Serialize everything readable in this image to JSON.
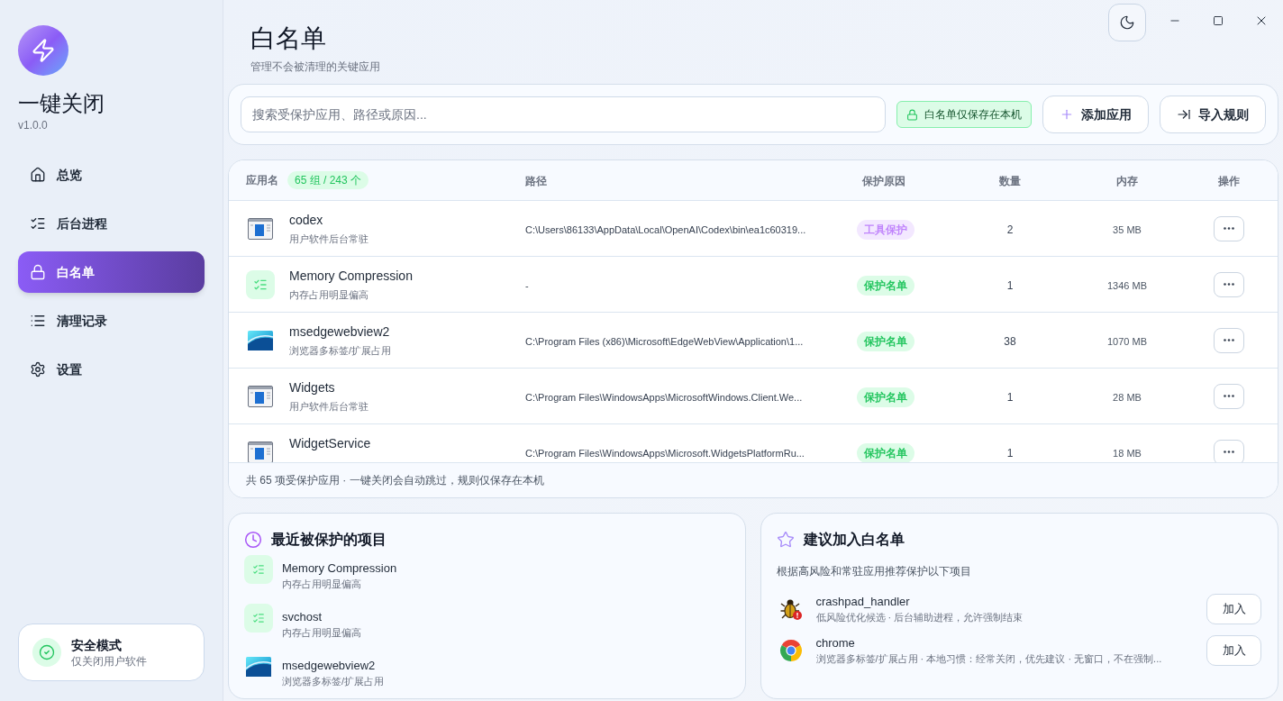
{
  "sidebar": {
    "app_name": "一键关闭",
    "version": "v1.0.0",
    "nav": [
      {
        "label": "总览",
        "selected": false
      },
      {
        "label": "后台进程",
        "selected": false
      },
      {
        "label": "白名单",
        "selected": true
      },
      {
        "label": "清理记录",
        "selected": false
      },
      {
        "label": "设置",
        "selected": false
      }
    ],
    "safe_mode": {
      "title": "安全模式",
      "subtitle": "仅关闭用户软件"
    }
  },
  "header": {
    "title": "白名单",
    "subtitle": "管理不会被清理的关键应用"
  },
  "toolbar": {
    "search": {
      "placeholder": "搜索受保护应用、路径或原因..."
    },
    "local_badge": "白名单仅保存在本机",
    "buttons": [
      {
        "kind": "add",
        "label": "添加应用"
      },
      {
        "kind": "import",
        "label": "导入规则"
      }
    ]
  },
  "table": {
    "columns": [
      "应用名",
      "路径",
      "保护原因",
      "数量",
      "内存",
      "操作"
    ],
    "count_badge": "65 组 / 243 个",
    "rows": [
      {
        "kind": "app",
        "name": "codex",
        "description": "用户软件后台常驻",
        "path": "C:\\Users\\86133\\AppData\\Local\\OpenAI\\Codex\\bin\\ea1c60319...",
        "reason": {
          "kind": "tool",
          "label": "工具保护"
        },
        "count": "2",
        "memory": "35 MB"
      },
      {
        "kind": "system",
        "name": "Memory Compression",
        "description": "内存占用明显偏高",
        "path": "-",
        "reason": {
          "kind": "whitelist",
          "label": "保护名单"
        },
        "count": "1",
        "memory": "1346 MB"
      },
      {
        "kind": "webview",
        "name": "msedgewebview2",
        "description": "浏览器多标签/扩展占用",
        "path": "C:\\Program Files (x86)\\Microsoft\\EdgeWebView\\Application\\1...",
        "reason": {
          "kind": "whitelist",
          "label": "保护名单"
        },
        "count": "38",
        "memory": "1070 MB"
      },
      {
        "kind": "app",
        "name": "Widgets",
        "description": "用户软件后台常驻",
        "path": "C:\\Program Files\\WindowsApps\\MicrosoftWindows.Client.We...",
        "reason": {
          "kind": "whitelist",
          "label": "保护名单"
        },
        "count": "1",
        "memory": "28 MB"
      },
      {
        "kind": "app",
        "name": "WidgetService",
        "path": "C:\\Program Files\\WindowsApps\\Microsoft.WidgetsPlatformRu...",
        "reason": {
          "kind": "whitelist",
          "label": "保护名单"
        },
        "count": "1",
        "memory": "18 MB"
      }
    ],
    "footer": "共 65 项受保护应用 · 一键关闭会自动跳过，规则仅保存在本机"
  },
  "recent": {
    "title": "最近被保护的项目",
    "items": [
      {
        "kind": "system",
        "name": "Memory Compression",
        "description": "内存占用明显偏高"
      },
      {
        "kind": "system",
        "name": "svchost",
        "description": "内存占用明显偏高"
      },
      {
        "kind": "webview",
        "name": "msedgewebview2",
        "description": "浏览器多标签/扩展占用"
      }
    ]
  },
  "suggestions": {
    "title": "建议加入白名单",
    "subtitle": "根据高风险和常驻应用推荐保护以下项目",
    "items": [
      {
        "kind": "handler",
        "name": "crashpad_handler",
        "description": "低风险优化候选 · 后台辅助进程，允许强制结束",
        "button": "加入"
      },
      {
        "kind": "browser",
        "name": "chrome",
        "description": "浏览器多标签/扩展占用 · 本地习惯：经常关闭，优先建议 · 无窗口，不在强制...",
        "button": "加入"
      }
    ]
  }
}
